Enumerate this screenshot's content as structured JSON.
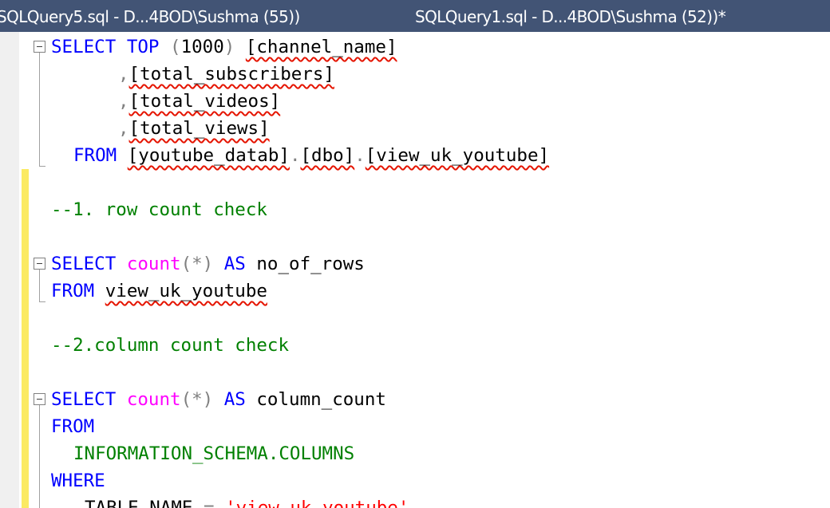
{
  "tabs": [
    {
      "label": "SQLQuery5.sql - D...4BOD\\Sushma (55))"
    },
    {
      "label": "SQLQuery1.sql - D...4BOD\\Sushma (52))*"
    }
  ],
  "code": {
    "l1": {
      "select": "SELECT",
      "top": "TOP",
      "paren_open": "(",
      "num": "1000",
      "paren_close": ")",
      "col": "[channel_name]"
    },
    "l2": {
      "comma": ",",
      "col": "[total_subscribers]"
    },
    "l3": {
      "comma": ",",
      "col": "[total_videos]"
    },
    "l4": {
      "comma": ",",
      "col": "[total_views]"
    },
    "l5": {
      "from": "FROM",
      "db": "[youtube_datab]",
      "dot1": ".",
      "schema": "[dbo]",
      "dot2": ".",
      "view": "[view_uk_youtube]"
    },
    "l7": {
      "comment": "--1. row count check"
    },
    "l9": {
      "select": "SELECT",
      "fn": "count",
      "args": "(*)",
      "as": "AS",
      "alias": "no_of_rows"
    },
    "l10": {
      "from": "FROM",
      "view": "view_uk_youtube"
    },
    "l12": {
      "comment": "--2.column count check"
    },
    "l14": {
      "select": "SELECT",
      "fn": "count",
      "args": "(*)",
      "as": "AS",
      "alias": "column_count"
    },
    "l15": {
      "from": "FROM"
    },
    "l16": {
      "schema_obj": "INFORMATION_SCHEMA.COLUMNS"
    },
    "l17": {
      "where": "WHERE"
    },
    "l18": {
      "col": "TABLE_NAME",
      "op": "=",
      "str": "'view_uk_youtube'"
    }
  },
  "colors": {
    "tabbar": "#425475",
    "keyword": "#0000ff",
    "function": "#ff00ff",
    "comment": "#008000",
    "string": "#ff0000",
    "changebar": "#fbea63"
  }
}
